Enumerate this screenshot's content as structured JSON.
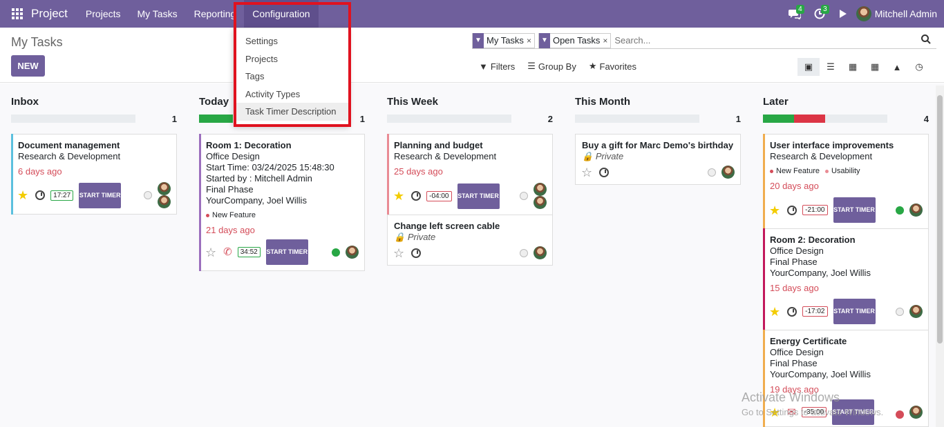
{
  "app": {
    "name": "Project"
  },
  "topbar": {
    "menus": [
      "Projects",
      "My Tasks",
      "Reporting",
      "Configuration"
    ],
    "messages_count": "4",
    "activities_count": "3",
    "user": "Mitchell Admin"
  },
  "control": {
    "title": "My Tasks",
    "new_label": "NEW",
    "facets": [
      "My Tasks",
      "Open Tasks"
    ],
    "search_placeholder": "Search...",
    "filters_label": "Filters",
    "groupby_label": "Group By",
    "favorites_label": "Favorites"
  },
  "config_menu": {
    "items": [
      "Settings",
      "Projects",
      "Tags",
      "Activity Types",
      "Task Timer Description"
    ]
  },
  "columns": [
    {
      "name": "Inbox",
      "count": "1"
    },
    {
      "name": "Today",
      "count": "1"
    },
    {
      "name": "This Week",
      "count": "2"
    },
    {
      "name": "This Month",
      "count": "1"
    },
    {
      "name": "Later",
      "count": "4"
    }
  ],
  "cards": {
    "inbox1": {
      "title": "Document management",
      "project": "Research & Development",
      "deadline": "6 days ago",
      "timer": "17:27",
      "button": "START TIMER"
    },
    "today1": {
      "title": "Room 1: Decoration",
      "project": "Office Design",
      "start": "Start Time: 03/24/2025 15:48:30",
      "started_by": "Started by : Mitchell Admin",
      "phase": "Final Phase",
      "partner": "YourCompany, Joel Willis",
      "tag": "New Feature",
      "deadline": "21 days ago",
      "timer": "34:52",
      "button": "START TIMER"
    },
    "week1": {
      "title": "Planning and budget",
      "project": "Research & Development",
      "deadline": "25 days ago",
      "timer": "-04:00",
      "button": "START TIMER"
    },
    "week2": {
      "title": "Change left screen cable",
      "private": "Private"
    },
    "month1": {
      "title": "Buy a gift for Marc Demo's birthday",
      "private": "Private"
    },
    "later1": {
      "title": "User interface improvements",
      "project": "Research & Development",
      "tag1": "New Feature",
      "tag2": "Usability",
      "deadline": "20 days ago",
      "timer": "-21:00",
      "button": "START TIMER"
    },
    "later2": {
      "title": "Room 2: Decoration",
      "project": "Office Design",
      "phase": "Final Phase",
      "partner": "YourCompany, Joel Willis",
      "deadline": "15 days ago",
      "timer": "-17:02",
      "button": "START TIMER"
    },
    "later3": {
      "title": "Energy Certificate",
      "project": "Office Design",
      "phase": "Final Phase",
      "partner": "YourCompany, Joel Willis",
      "deadline": "19 days ago",
      "timer": "-35:00",
      "button": "START TIMER"
    }
  },
  "watermark": {
    "line1": "Activate Windows",
    "line2": "Go to Settings to activate Windows."
  },
  "colors": {
    "brand": "#6f5f9c",
    "deadline": "#d44c59",
    "highlight": "#e0121f"
  }
}
